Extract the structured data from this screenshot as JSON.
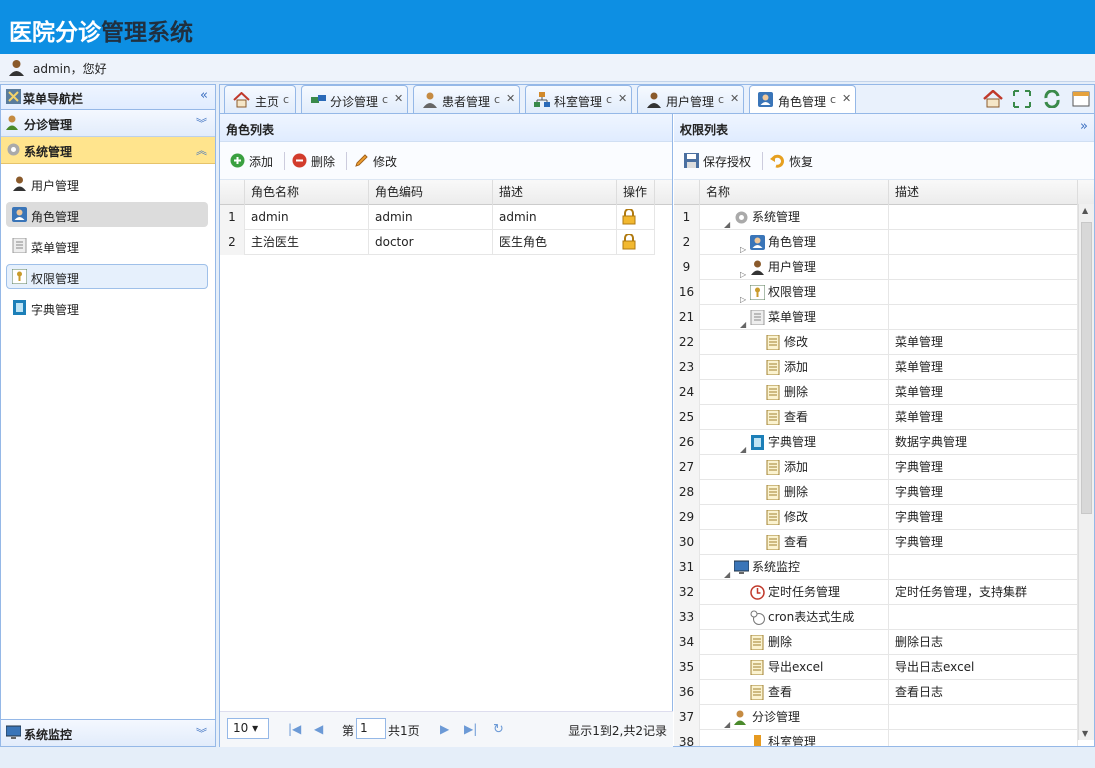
{
  "header": {
    "title_part1": "医院分诊",
    "title_part2": "管理系统"
  },
  "userbar": {
    "text": "admin，您好"
  },
  "sidebar": {
    "title": "菜单导航栏",
    "groups": [
      {
        "label": "分诊管理"
      },
      {
        "label": "系统管理"
      }
    ],
    "items": [
      {
        "label": "用户管理"
      },
      {
        "label": "角色管理"
      },
      {
        "label": "菜单管理"
      },
      {
        "label": "权限管理"
      },
      {
        "label": "字典管理"
      }
    ],
    "bottom_label": "系统监控"
  },
  "tabs": [
    {
      "label": "主页"
    },
    {
      "label": "分诊管理"
    },
    {
      "label": "患者管理"
    },
    {
      "label": "科室管理"
    },
    {
      "label": "用户管理"
    },
    {
      "label": "角色管理"
    }
  ],
  "role_panel": {
    "title": "角色列表",
    "toolbar": {
      "add": "添加",
      "delete": "删除",
      "edit": "修改"
    },
    "columns": [
      "角色名称",
      "角色编码",
      "描述",
      "操作"
    ],
    "rows": [
      {
        "n": "1",
        "name": "admin",
        "code": "admin",
        "desc": "admin"
      },
      {
        "n": "2",
        "name": "主治医生",
        "code": "doctor",
        "desc": "医生角色"
      }
    ],
    "pager": {
      "page_size": "10",
      "page_prefix": "第",
      "page_num": "1",
      "page_suffix": "共1页",
      "summary": "显示1到2,共2记录"
    }
  },
  "perm_panel": {
    "title": "权限列表",
    "toolbar": {
      "save": "保存授权",
      "restore": "恢复"
    },
    "columns": [
      "名称",
      "描述"
    ],
    "rows": [
      {
        "n": "1",
        "name": "系统管理",
        "desc": "",
        "icon": "gear-icon",
        "exp": "open"
      },
      {
        "n": "2",
        "name": "角色管理",
        "desc": "",
        "icon": "role-icon",
        "exp": "closed"
      },
      {
        "n": "9",
        "name": "用户管理",
        "desc": "",
        "icon": "user-icon",
        "exp": "closed"
      },
      {
        "n": "16",
        "name": "权限管理",
        "desc": "",
        "icon": "key-icon",
        "exp": "closed"
      },
      {
        "n": "21",
        "name": "菜单管理",
        "desc": "",
        "icon": "menu-icon",
        "exp": "open"
      },
      {
        "n": "22",
        "name": "修改",
        "desc": "菜单管理",
        "icon": "page-icon",
        "exp": ""
      },
      {
        "n": "23",
        "name": "添加",
        "desc": "菜单管理",
        "icon": "page-icon",
        "exp": ""
      },
      {
        "n": "24",
        "name": "删除",
        "desc": "菜单管理",
        "icon": "page-icon",
        "exp": ""
      },
      {
        "n": "25",
        "name": "查看",
        "desc": "菜单管理",
        "icon": "page-icon",
        "exp": ""
      },
      {
        "n": "26",
        "name": "字典管理",
        "desc": "数据字典管理",
        "icon": "dict-icon",
        "exp": "open"
      },
      {
        "n": "27",
        "name": "添加",
        "desc": "字典管理",
        "icon": "page-icon",
        "exp": ""
      },
      {
        "n": "28",
        "name": "删除",
        "desc": "字典管理",
        "icon": "page-icon",
        "exp": ""
      },
      {
        "n": "29",
        "name": "修改",
        "desc": "字典管理",
        "icon": "page-icon",
        "exp": ""
      },
      {
        "n": "30",
        "name": "查看",
        "desc": "字典管理",
        "icon": "page-icon",
        "exp": ""
      },
      {
        "n": "31",
        "name": "系统监控",
        "desc": "",
        "icon": "monitor-icon",
        "exp": "open"
      },
      {
        "n": "32",
        "name": "定时任务管理",
        "desc": "定时任务管理，支持集群",
        "icon": "clock-icon",
        "exp": ""
      },
      {
        "n": "33",
        "name": "cron表达式生成",
        "desc": "",
        "icon": "cron-icon",
        "exp": ""
      },
      {
        "n": "34",
        "name": "删除",
        "desc": "删除日志",
        "icon": "page-icon",
        "exp": ""
      },
      {
        "n": "35",
        "name": "导出excel",
        "desc": "导出日志excel",
        "icon": "page-icon",
        "exp": ""
      },
      {
        "n": "36",
        "name": "查看",
        "desc": "查看日志",
        "icon": "page-icon",
        "exp": ""
      },
      {
        "n": "37",
        "name": "分诊管理",
        "desc": "",
        "icon": "triage-icon",
        "exp": "open"
      },
      {
        "n": "38",
        "name": "科室管理",
        "desc": "",
        "icon": "dept-icon",
        "exp": "open"
      }
    ]
  }
}
